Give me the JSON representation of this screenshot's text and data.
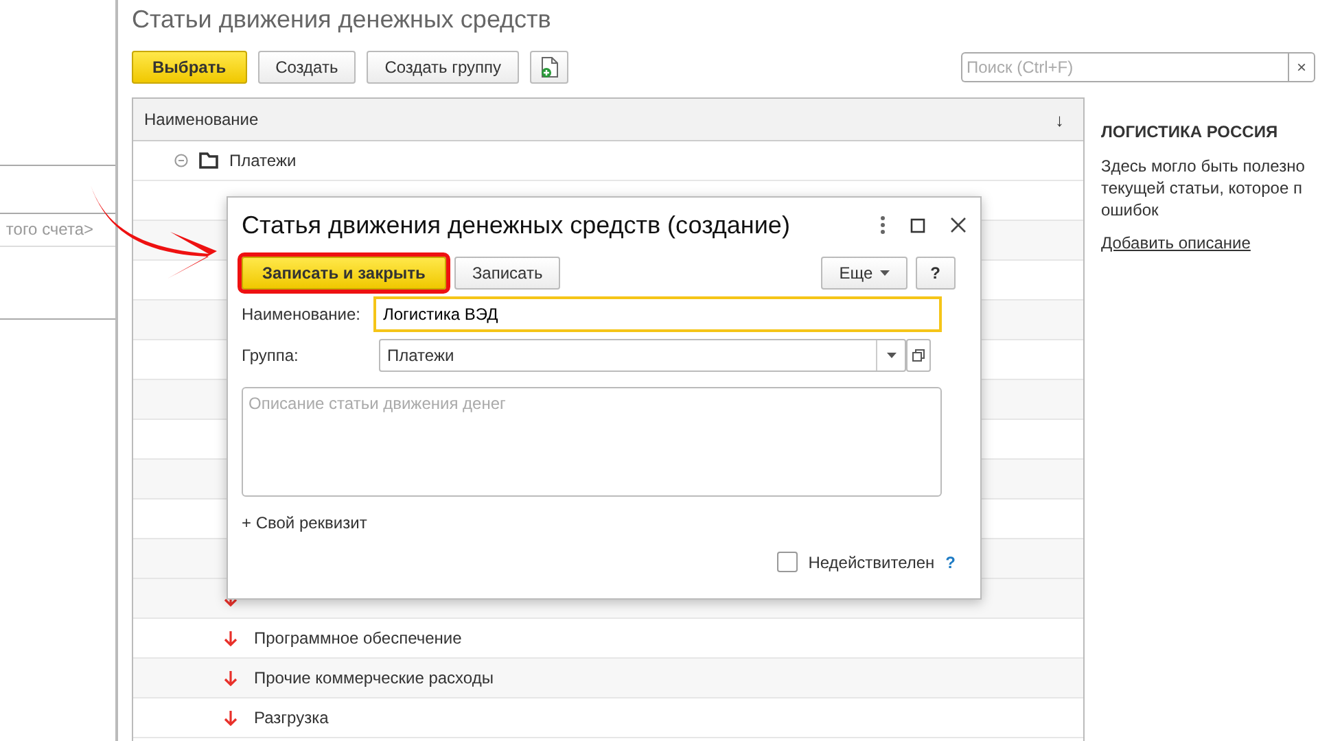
{
  "left_pane": {
    "texts": [
      "того счета>"
    ]
  },
  "title": "Статьи движения денежных средств",
  "toolbar": {
    "buttons": [
      {
        "label": "Выбрать",
        "kind": "primary"
      },
      {
        "label": "Создать",
        "kind": "plain"
      },
      {
        "label": "Создать группу",
        "kind": "plain"
      },
      {
        "kind": "copy-icon"
      }
    ],
    "search": {
      "placeholder": "Поиск (Ctrl+F)",
      "clear": "×"
    }
  },
  "table": {
    "columns": [
      {
        "label": "Наименование",
        "sort": "↓"
      }
    ],
    "rows": [
      {
        "name": "Платежи",
        "kind": "group",
        "expanded": true
      },
      {
        "kind": "expense"
      },
      {
        "name": "Программное обеспечение",
        "kind": "expense"
      },
      {
        "name": "Прочие коммерческие расходы",
        "kind": "expense"
      },
      {
        "name": "Разгрузка",
        "kind": "expense"
      }
    ]
  },
  "info": {
    "title": "ЛОГИСТИКА РОССИЯ",
    "lines": [
      "Здесь могло быть полезно",
      "текущей статьи, которое п",
      "ошибок"
    ],
    "link": "Добавить описание"
  },
  "dialog": {
    "title": "Статья движения денежных средств (создание)",
    "buttons": [
      {
        "label": "Записать и закрыть",
        "kind": "primary",
        "highlighted": true
      },
      {
        "label": "Записать",
        "kind": "plain",
        "highlighted": false
      }
    ],
    "more": "Еще",
    "help": "?",
    "fields": [
      {
        "label": "Наименование:",
        "value": "Логистика ВЭД",
        "kind": "text",
        "focused": true
      },
      {
        "label": "Группа:",
        "value": "Платежи",
        "kind": "select",
        "focused": false
      }
    ],
    "description": {
      "placeholder": "Описание статьи движения денег"
    },
    "custom_attribute": "+ Свой реквизит",
    "inactive": {
      "label": "Недействителен",
      "checked": false
    },
    "inactive_help": "?"
  }
}
